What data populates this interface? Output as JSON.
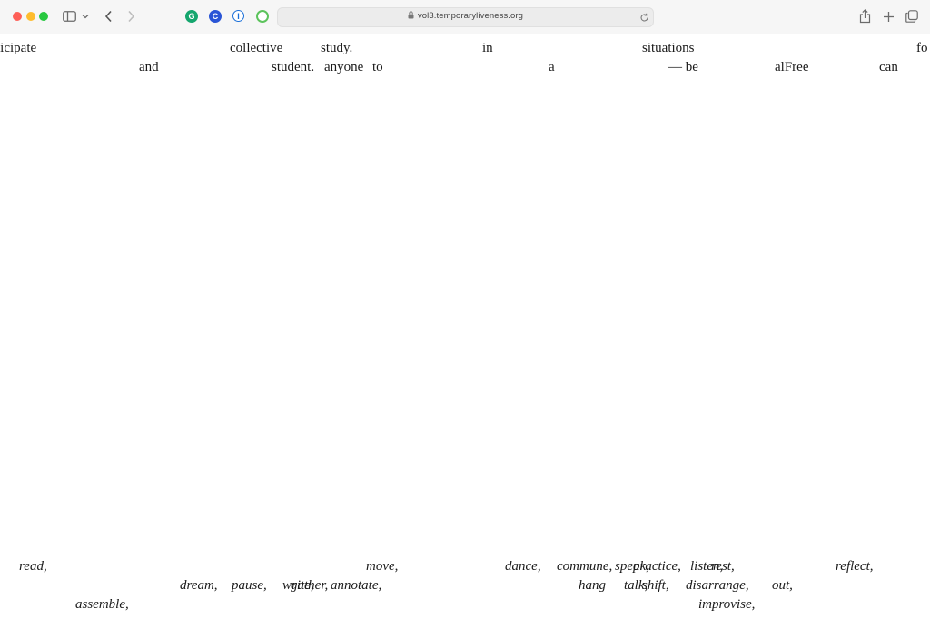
{
  "browser": {
    "url": "vol3.temporaryliveness.org",
    "icons": {
      "sidebar": "sidebar-icon",
      "sidebar_menu": "chevron-down-icon",
      "back": "chevron-left-icon",
      "forward": "chevron-right-icon",
      "lock": "lock-icon",
      "reload": "reload-icon",
      "share": "share-icon",
      "new_tab": "plus-icon",
      "tabs": "tabs-overview-icon"
    },
    "extensions": [
      {
        "name": "grammarly-icon",
        "glyph": "G",
        "color": "#15a66e"
      },
      {
        "name": "c-extension-icon",
        "glyph": "C",
        "color": "#2a55d6"
      },
      {
        "name": "password-manager-icon",
        "glyph": "I",
        "color": "#1a6fd8"
      },
      {
        "name": "circle-extension-icon",
        "glyph": "",
        "color": "#5cc35c"
      }
    ],
    "traffic_colors": [
      "#fe5f57",
      "#febc2e",
      "#28c840"
    ]
  },
  "words_upper": [
    {
      "text": "ticipate"
    },
    {
      "text": "collective"
    },
    {
      "text": "study."
    },
    {
      "text": "in"
    },
    {
      "text": "situations"
    },
    {
      "text": "fo"
    },
    {
      "text": "and"
    },
    {
      "text": "student."
    },
    {
      "text": "anyone"
    },
    {
      "text": "to"
    },
    {
      "text": "a"
    },
    {
      "text": "— be"
    },
    {
      "text": "alFree"
    },
    {
      "text": "can"
    }
  ],
  "words_lower": [
    {
      "text": "read,"
    },
    {
      "text": "move,"
    },
    {
      "text": "dance,"
    },
    {
      "text": "commune,"
    },
    {
      "text": "speak,"
    },
    {
      "text": "practice,"
    },
    {
      "text": "listen,"
    },
    {
      "text": "rest,"
    },
    {
      "text": "reflect,"
    },
    {
      "text": "dream,"
    },
    {
      "text": "pause,"
    },
    {
      "text": "write,"
    },
    {
      "text": "gather,"
    },
    {
      "text": "annotate,"
    },
    {
      "text": "hang"
    },
    {
      "text": "talk,"
    },
    {
      "text": "shift,"
    },
    {
      "text": "disarrange,"
    },
    {
      "text": "out,"
    },
    {
      "text": "assemble,"
    },
    {
      "text": "improvise,"
    }
  ]
}
